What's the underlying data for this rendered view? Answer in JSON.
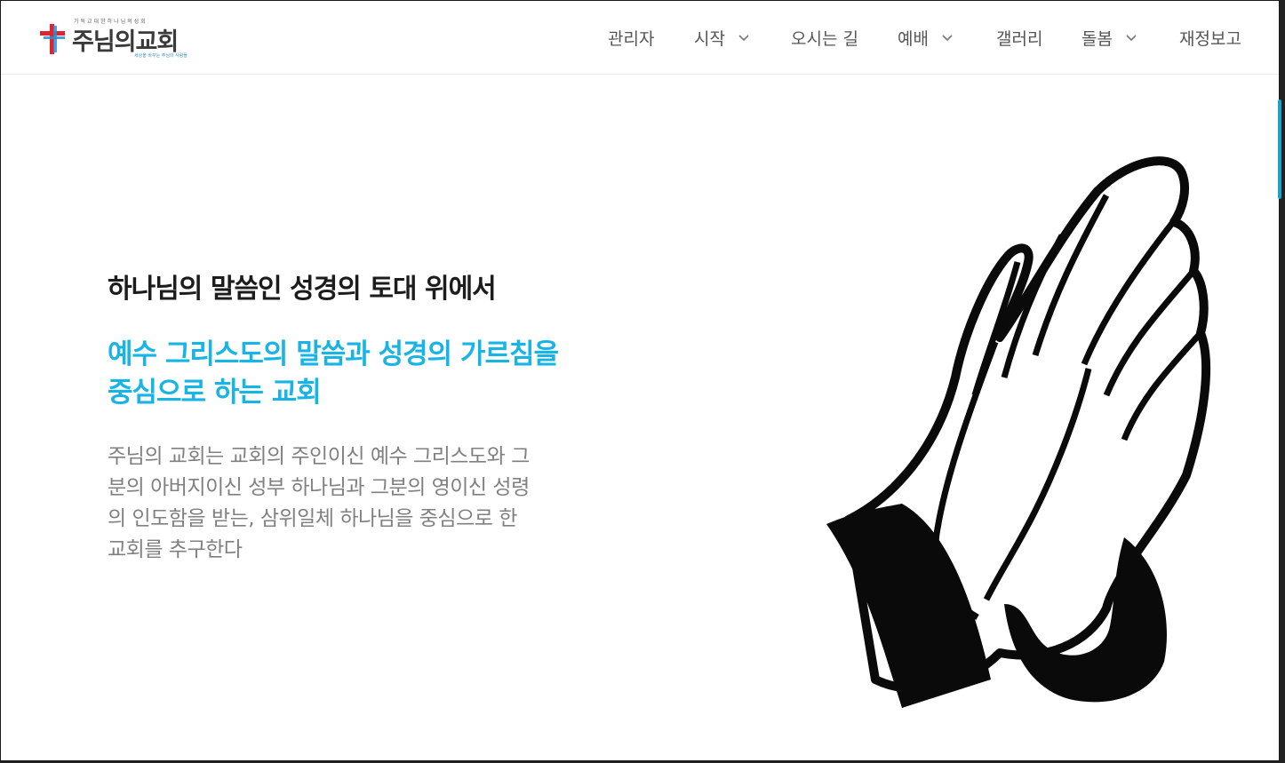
{
  "header": {
    "logo": {
      "tagline": "기독교대한하나님의성회",
      "brand": "주님의교회",
      "slogan": "세상을 바꾸는 주님의 사람들"
    },
    "nav": [
      {
        "label": "관리자",
        "has_dropdown": false
      },
      {
        "label": "시작",
        "has_dropdown": true
      },
      {
        "label": "오시는 길",
        "has_dropdown": false
      },
      {
        "label": "예배",
        "has_dropdown": true
      },
      {
        "label": "갤러리",
        "has_dropdown": false
      },
      {
        "label": "돌봄",
        "has_dropdown": true
      },
      {
        "label": "재정보고",
        "has_dropdown": false
      }
    ]
  },
  "hero": {
    "heading": "하나님의 말씀인 성경의 토대 위에서",
    "subheading_lines": [
      "예수 그리스도의 말씀과 성경의 가르침을",
      "중심으로 하는 교회"
    ],
    "description_lines": [
      "주님의 교회는 교회의 주인이신 예수 그리스도와 그",
      "분의 아버지이신 성부 하나님과 그분의 영이신 성령",
      "의 인도함을 받는, 삼위일체 하나님을 중심으로 한",
      "교회를 추구한다"
    ],
    "image_icon": "praying-hands-icon"
  },
  "colors": {
    "accent": "#19b4e6",
    "heading": "#1c1c1c",
    "body_text": "#808080",
    "nav_text": "#555555",
    "logo_cross_red": "#e0242f",
    "logo_cross_blue": "#2a8fd0"
  }
}
